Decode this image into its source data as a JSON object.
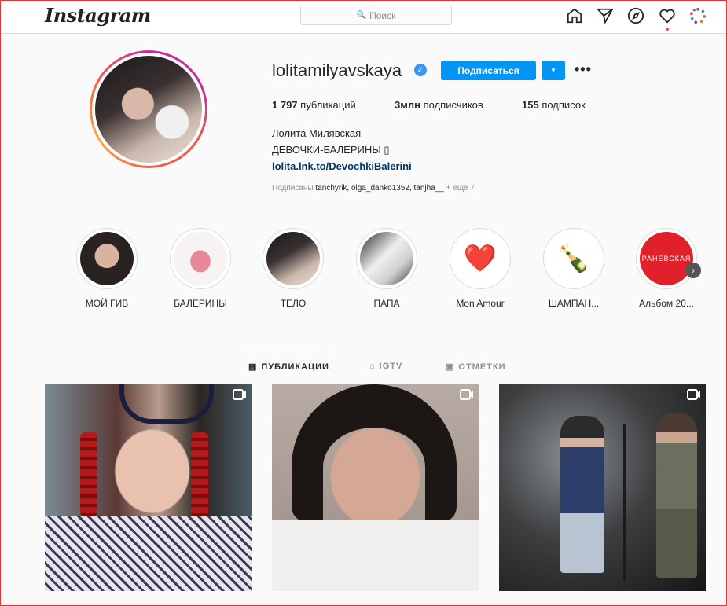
{
  "header": {
    "logo": "Instagram",
    "search_placeholder": "Поиск"
  },
  "profile": {
    "username": "lolitamilyavskaya",
    "follow_label": "Подписаться",
    "more_label": "•••",
    "stats": {
      "posts_count": "1 797",
      "posts_label": "публикаций",
      "followers_count": "3млн",
      "followers_label": "подписчиков",
      "following_count": "155",
      "following_label": "подписок"
    },
    "full_name": "Лолита Милявская",
    "bio": "ДЕВОЧКИ-БАЛЕРИНЫ ▯",
    "link": "lolita.lnk.to/DevochkiBalerini",
    "followed_by_prefix": "Подписаны",
    "followed_by_names": "tanchyrik, olga_danko1352, tanjha__",
    "followed_by_more": "+ еще 7"
  },
  "highlights": [
    {
      "label": "МОЙ ГИВ"
    },
    {
      "label": "БАЛЕРИНЫ"
    },
    {
      "label": "ТЕЛО"
    },
    {
      "label": "ПАПА"
    },
    {
      "label": "Mon Amour"
    },
    {
      "label": "ШАМПАН..."
    },
    {
      "label": "Альбом 20..."
    }
  ],
  "highlight_icons": {
    "heart": "❤️",
    "champagne": "🍾",
    "album_text": "РАНЕВСКАЯ"
  },
  "tabs": {
    "posts": "ПУБЛИКАЦИИ",
    "igtv": "IGTV",
    "tagged": "ОТМЕТКИ"
  },
  "colors": {
    "accent": "#0095f6",
    "verified": "#3897f0",
    "notification": "#ed4956"
  }
}
